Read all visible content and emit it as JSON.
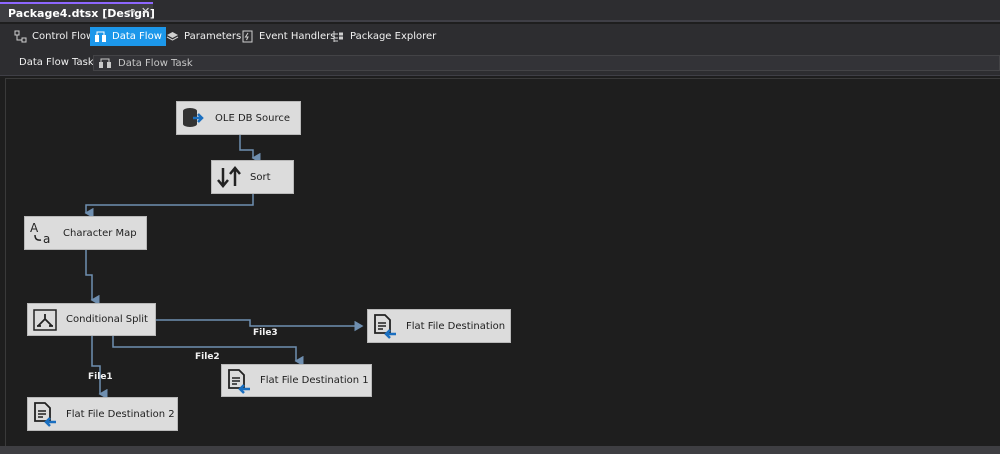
{
  "document_tab": {
    "title": "Package4.dtsx [Design]",
    "pin_icon": "pin-icon",
    "close_glyph": "✕"
  },
  "designer_tabs": [
    {
      "label": "Control Flow",
      "icon": "control-flow-icon",
      "active": false
    },
    {
      "label": "Data Flow",
      "icon": "data-flow-icon",
      "active": true
    },
    {
      "label": "Parameters",
      "icon": "parameters-icon",
      "active": false
    },
    {
      "label": "Event Handlers",
      "icon": "event-handlers-icon",
      "active": false
    },
    {
      "label": "Package Explorer",
      "icon": "package-explorer-icon",
      "active": false
    }
  ],
  "task_selector": {
    "label": "Data Flow Task:",
    "value": "Data Flow Task",
    "icon": "data-flow-task-icon"
  },
  "components": {
    "ole_db_source": {
      "label": "OLE DB Source",
      "icon": "database-source-icon"
    },
    "sort": {
      "label": "Sort",
      "icon": "sort-icon"
    },
    "character_map": {
      "label": "Character Map",
      "icon": "character-map-icon"
    },
    "conditional_split": {
      "label": "Conditional Split",
      "icon": "conditional-split-icon"
    },
    "flat_file_destination": {
      "label": "Flat File Destination",
      "icon": "flat-file-destination-icon"
    },
    "flat_file_destination_1": {
      "label": "Flat File Destination 1",
      "icon": "flat-file-destination-icon"
    },
    "flat_file_destination_2": {
      "label": "Flat File Destination 2",
      "icon": "flat-file-destination-icon"
    }
  },
  "path_labels": {
    "file1": "File1",
    "file2": "File2",
    "file3": "File3"
  },
  "colors": {
    "accent": "#1c97ea",
    "tab_border": "#8e67ff",
    "canvas": "#1e1e1e",
    "component": "#dcdcdc",
    "path": "#6f8fb0"
  }
}
